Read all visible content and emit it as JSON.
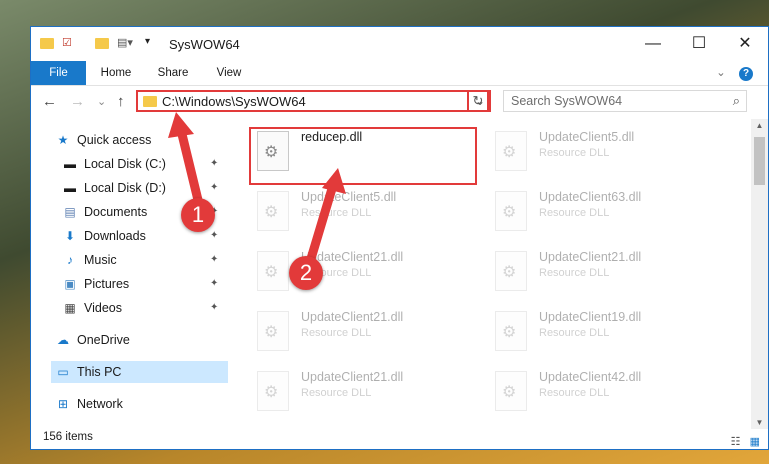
{
  "window": {
    "title": "SysWOW64",
    "controls": {
      "minimize": "—",
      "maximize": "☐",
      "close": "✕"
    }
  },
  "ribbon": {
    "tabs": [
      "File",
      "Home",
      "Share",
      "View"
    ],
    "expand_icon": "⌄",
    "help_icon": "?"
  },
  "address": {
    "path": "C:\\Windows\\SysWOW64",
    "search_placeholder": "Search SysWOW64",
    "search_icon": "⌕",
    "refresh_icon": "↻",
    "dropdown_icon": "⌄"
  },
  "nav": {
    "back": "←",
    "forward": "→",
    "recent": "⌄",
    "up": "↑",
    "items": [
      {
        "label": "Quick access",
        "icon": "★"
      },
      {
        "label": "Local Disk (C:)",
        "icon": "▬"
      },
      {
        "label": "Local Disk (D:)",
        "icon": "▬"
      },
      {
        "label": "Documents",
        "icon": "▤"
      },
      {
        "label": "Downloads",
        "icon": "⬇"
      },
      {
        "label": "Music",
        "icon": "♪"
      },
      {
        "label": "Pictures",
        "icon": "▣"
      },
      {
        "label": "Videos",
        "icon": "▦"
      },
      {
        "label": "OneDrive",
        "icon": "☁"
      },
      {
        "label": "This PC",
        "icon": "▭"
      },
      {
        "label": "Network",
        "icon": "⊞"
      }
    ],
    "pin_icon": "📌"
  },
  "files": [
    {
      "name": "reducep.dll",
      "type": ""
    },
    {
      "name": "UpdateClient5.dll",
      "type": "Resource DLL"
    },
    {
      "name": "UpdateClient5.dll",
      "type": "Resource DLL"
    },
    {
      "name": "UpdateClient63.dll",
      "type": "Resource DLL"
    },
    {
      "name": "UpdateClient21.dll",
      "type": "Resource DLL"
    },
    {
      "name": "UpdateClient21.dll",
      "type": "Resource DLL"
    },
    {
      "name": "UpdateClient21.dll",
      "type": "Resource DLL"
    },
    {
      "name": "UpdateClient19.dll",
      "type": "Resource DLL"
    },
    {
      "name": "UpdateClient21.dll",
      "type": "Resource DLL"
    },
    {
      "name": "UpdateClient42.dll",
      "type": "Resource DLL"
    }
  ],
  "status": {
    "count": "156 items",
    "details_view": "☷",
    "tiles_view": "▦"
  },
  "annotations": {
    "badge1": "1",
    "badge2": "2"
  },
  "colors": {
    "accent": "#1979ca",
    "highlight": "#e23a3a",
    "selection": "#cce8ff"
  }
}
